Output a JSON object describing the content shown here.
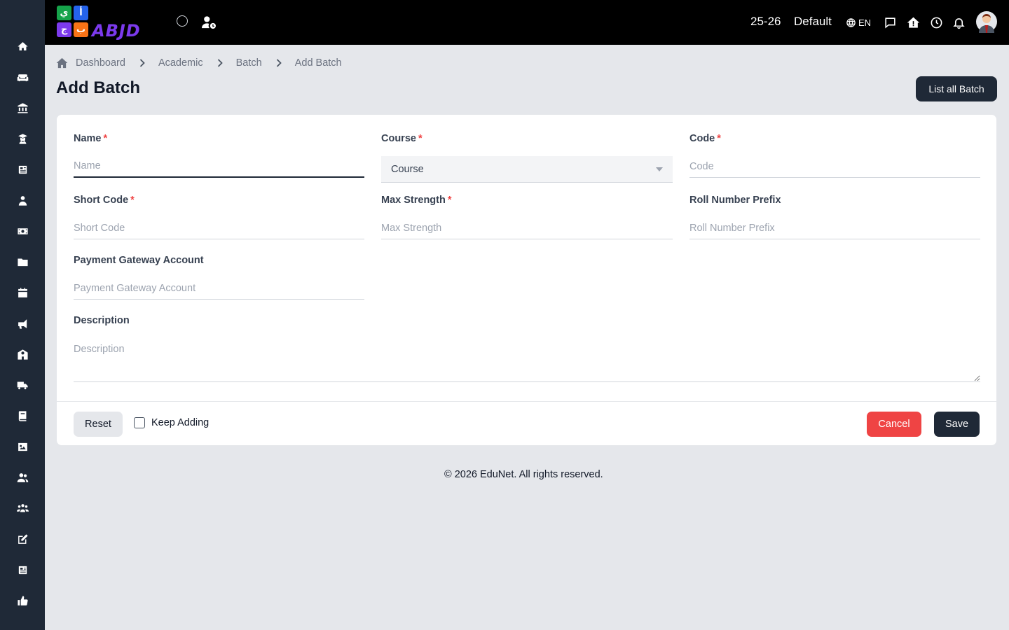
{
  "header": {
    "session": "25-26",
    "profile": "Default",
    "language": "EN"
  },
  "breadcrumb": [
    "Dashboard",
    "Academic",
    "Batch",
    "Add Batch"
  ],
  "page": {
    "title": "Add Batch",
    "list_button": "List all Batch"
  },
  "form": {
    "name": {
      "label": "Name",
      "placeholder": "Name",
      "value": ""
    },
    "course": {
      "label": "Course",
      "selected": "Course"
    },
    "code": {
      "label": "Code",
      "placeholder": "Code",
      "value": ""
    },
    "short_code": {
      "label": "Short Code",
      "placeholder": "Short Code",
      "value": ""
    },
    "max_strength": {
      "label": "Max Strength",
      "placeholder": "Max Strength",
      "value": ""
    },
    "roll_prefix": {
      "label": "Roll Number Prefix",
      "placeholder": "Roll Number Prefix",
      "value": ""
    },
    "payment_gateway": {
      "label": "Payment Gateway Account",
      "placeholder": "Payment Gateway Account",
      "value": ""
    },
    "description": {
      "label": "Description",
      "placeholder": "Description",
      "value": ""
    },
    "required_mark": "*"
  },
  "actions": {
    "reset": "Reset",
    "keep_adding": "Keep Adding",
    "cancel": "Cancel",
    "save": "Save"
  },
  "footer": "© 2026 EduNet. All rights reserved.",
  "logo": {
    "tiles": [
      "ي",
      "أ",
      "ج",
      "ب"
    ],
    "text": "ABJD"
  },
  "colors": {
    "sidebar": "#1f2937",
    "header": "#000000",
    "primary": "#1f2937",
    "danger": "#ef4444",
    "background": "#e5e7eb"
  }
}
